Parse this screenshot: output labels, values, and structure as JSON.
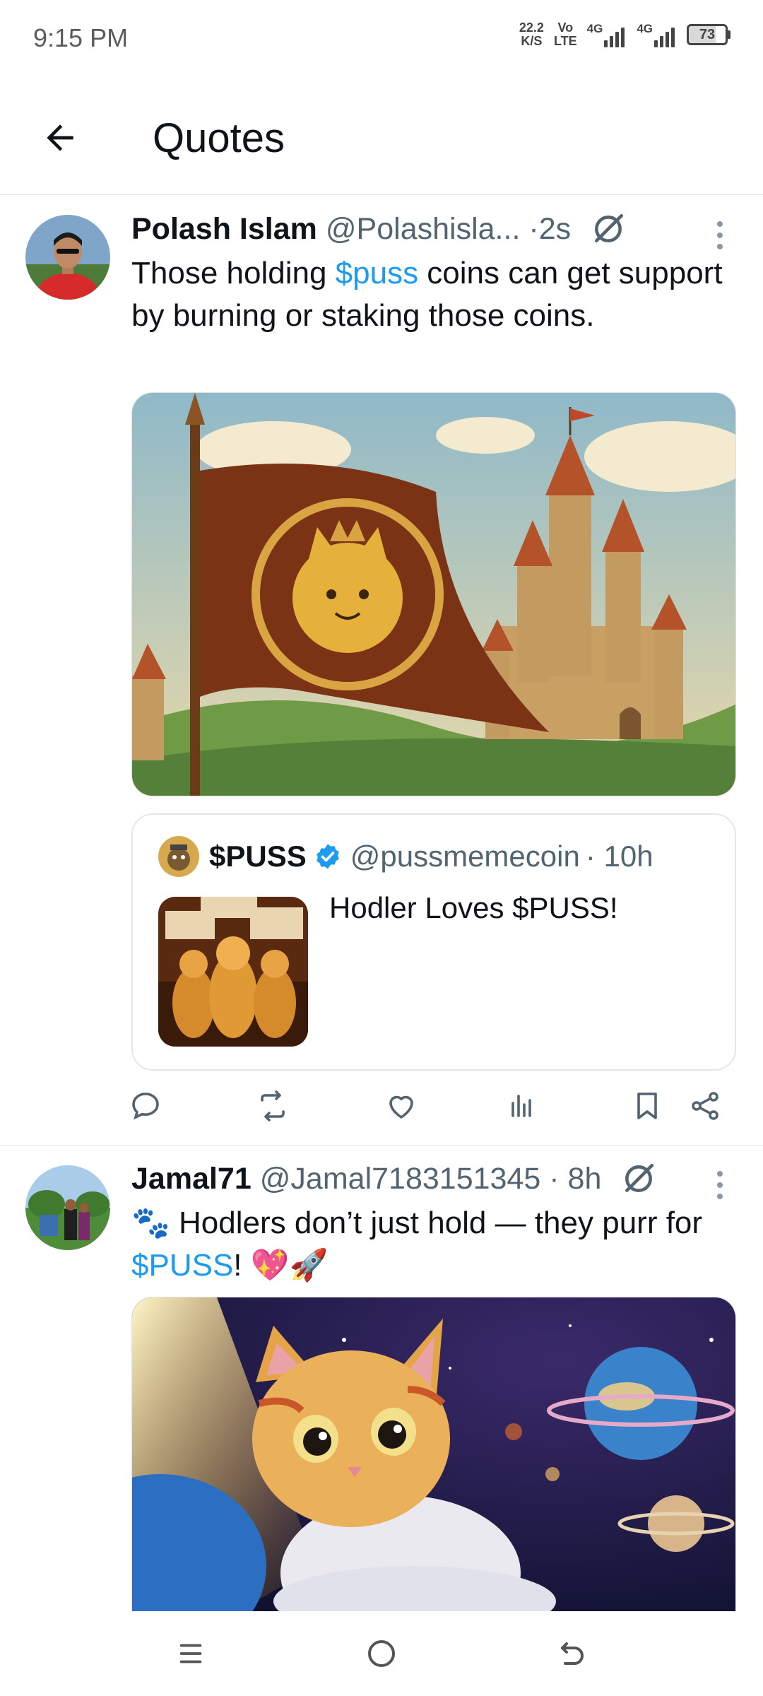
{
  "status_bar": {
    "time": "9:15 PM",
    "net_speed_value": "22.2",
    "net_speed_unit": "K/S",
    "volte_top": "Vo",
    "volte_bottom": "LTE",
    "sim1_label": "4G",
    "sim2_label": "4G",
    "battery": "73"
  },
  "header": {
    "title": "Quotes",
    "back_icon": "arrow-left-icon"
  },
  "posts": [
    {
      "author": "Polash Islam",
      "handle": "@Polashisla...",
      "time": "·2s",
      "text_before": "Those holding ",
      "link": "$puss",
      "text_after": " coins can get support by burning or staking those coins.",
      "quote": {
        "name": "$PUSS",
        "handle": "@pussmemecoin",
        "time": "· 10h",
        "text": "Hodler Loves $PUSS!"
      }
    },
    {
      "author": "Jamal71",
      "handle": "@Jamal7183151345",
      "time": "· 8h",
      "emoji_lead": "🐾",
      "text_before": " Hodlers don’t just hold — they purr for ",
      "link": "$PUSS",
      "text_after": "! 💖🚀"
    }
  ],
  "colors": {
    "link": "#1d9bf0",
    "muted": "#536471",
    "text": "#0f1419",
    "verified": "#1d9bf0"
  }
}
